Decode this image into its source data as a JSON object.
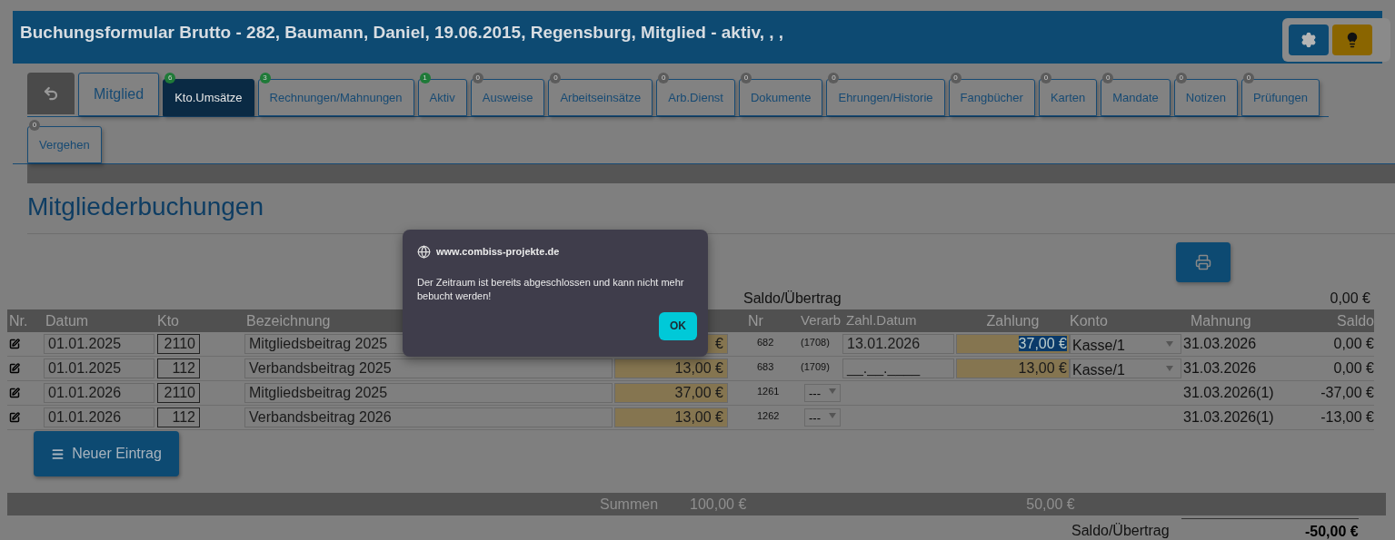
{
  "title": "Buchungsformular Brutto - 282, Baumann, Daniel, 19.06.2015, Regensburg, Mitglied - aktiv, , ,",
  "tabs": [
    {
      "label": "Mitglied",
      "selected": false
    },
    {
      "label": "Kto.Umsätze",
      "badge": "6",
      "color": "#1f7a38",
      "selected": true
    },
    {
      "label": "Rechnungen/Mahnungen",
      "badge": "3",
      "color": "#1f7a38",
      "selected": false
    },
    {
      "label": "Aktiv",
      "badge": "1",
      "color": "#1f7a38",
      "selected": false
    },
    {
      "label": "Ausweise",
      "badge": "0",
      "color": "#5c5c5c",
      "selected": false
    },
    {
      "label": "Arbeitseinsätze",
      "badge": "0",
      "color": "#5c5c5c",
      "selected": false
    },
    {
      "label": "Arb.Dienst",
      "badge": "0",
      "color": "#5c5c5c",
      "selected": false
    },
    {
      "label": "Dokumente",
      "badge": "0",
      "color": "#5c5c5c",
      "selected": false
    },
    {
      "label": "Ehrungen/Historie",
      "badge": "0",
      "color": "#5c5c5c",
      "selected": false
    },
    {
      "label": "Fangbücher",
      "badge": "0",
      "color": "#5c5c5c",
      "selected": false
    },
    {
      "label": "Karten",
      "badge": "0",
      "color": "#5c5c5c",
      "selected": false
    },
    {
      "label": "Mandate",
      "badge": "0",
      "color": "#5c5c5c",
      "selected": false
    },
    {
      "label": "Notizen",
      "badge": "0",
      "color": "#5c5c5c",
      "selected": false
    },
    {
      "label": "Prüfungen",
      "badge": "0",
      "color": "#5c5c5c",
      "selected": false
    },
    {
      "label": "Vergehen",
      "badge": "0",
      "color": "#5c5c5c",
      "selected": false
    }
  ],
  "section_title": "Mitgliederbuchungen",
  "saldo_top": {
    "label": "Saldo/Übertrag",
    "value": "0,00 €"
  },
  "columns": [
    "Nr.",
    "Datum",
    "Kto",
    "Bezeichnung",
    "Nr",
    "Verarb",
    "Zahl.Datum",
    "Zahlung",
    "Konto",
    "Mahnung",
    "Saldo"
  ],
  "rows": [
    {
      "kind": "booked",
      "datum": "01.01.2025",
      "kto": "2110",
      "bezeichnung": "Mitgliedsbeitrag 2025",
      "betrag": "€",
      "nr": "682",
      "verarb": "(1708)",
      "zahl_datum": "13.01.2026",
      "zahlung": "37,00 €",
      "zahlung_highlighted": true,
      "konto": "Kasse/1",
      "mahnung": "31.03.2026",
      "saldo": "0,00 €"
    },
    {
      "kind": "booked",
      "datum": "01.01.2025",
      "kto": "112",
      "bezeichnung": "Verbandsbeitrag 2025",
      "betrag": "13,00 €",
      "nr": "683",
      "verarb": "(1709)",
      "zahl_datum": "__.__.____",
      "zahlung": "13,00 €",
      "zahlung_highlighted": false,
      "konto": "Kasse/1",
      "mahnung": "31.03.2026",
      "saldo": "0,00 €"
    },
    {
      "kind": "open",
      "datum": "01.01.2026",
      "kto": "2110",
      "bezeichnung": "Mitgliedsbeitrag 2025",
      "betrag": "37,00 €",
      "nr": "1261",
      "verarb": "---",
      "mahnung": "31.03.2026(1)",
      "saldo": "-37,00 €"
    },
    {
      "kind": "open",
      "datum": "01.01.2026",
      "kto": "112",
      "bezeichnung": "Verbandsbeitrag 2026",
      "betrag": "13,00 €",
      "nr": "1262",
      "verarb": "---",
      "mahnung": "31.03.2026(1)",
      "saldo": "-13,00 €"
    }
  ],
  "new_entry_button": "Neuer Eintrag",
  "sums": {
    "label": "Summen",
    "betrag": "100,00 €",
    "zahlung": "50,00 €"
  },
  "saldo_bottom": {
    "label": "Saldo/Übertrag",
    "value": "-50,00 €"
  },
  "dialog": {
    "origin": "www.combiss-projekte.de",
    "message": "Der Zeitraum ist bereits abgeschlossen und kann nicht mehr bebucht werden!",
    "ok": "OK"
  }
}
